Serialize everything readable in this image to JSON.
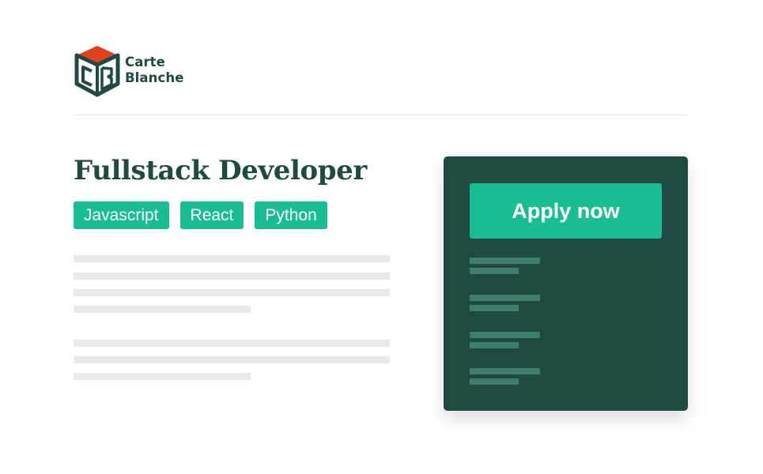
{
  "brand": {
    "line1": "Carte",
    "line2": "Blanche",
    "colors": {
      "dark_green": "#1f4a41",
      "accent_green": "#18bd91",
      "roof_red": "#e0401c"
    }
  },
  "job": {
    "title": "Fullstack Developer",
    "tags": [
      "Javascript",
      "React",
      "Python"
    ]
  },
  "cta": {
    "label": "Apply now"
  },
  "icons": {
    "logo": "carte-blanche-cube-logo-icon"
  }
}
